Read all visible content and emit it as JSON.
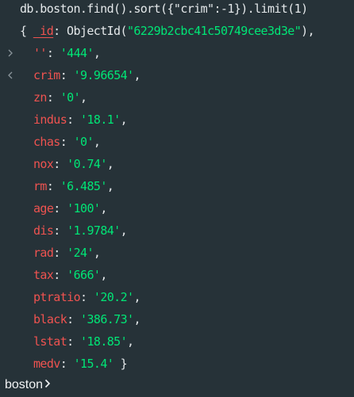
{
  "command": "db.boston.find().sort({\"crim\":-1}).limit(1)",
  "result": {
    "open_brace": "{",
    "id_key": "_id",
    "id_func": "ObjectId(",
    "id_value": "\"6229b2cbc41c50749cee3d3e\"",
    "id_close": "),",
    "fields": [
      {
        "key": "''",
        "value": "'444'"
      },
      {
        "key": "crim",
        "value": "'9.96654'"
      },
      {
        "key": "zn",
        "value": "'0'"
      },
      {
        "key": "indus",
        "value": "'18.1'"
      },
      {
        "key": "chas",
        "value": "'0'"
      },
      {
        "key": "nox",
        "value": "'0.74'"
      },
      {
        "key": "rm",
        "value": "'6.485'"
      },
      {
        "key": "age",
        "value": "'100'"
      },
      {
        "key": "dis",
        "value": "'1.9784'"
      },
      {
        "key": "rad",
        "value": "'24'"
      },
      {
        "key": "tax",
        "value": "'666'"
      },
      {
        "key": "ptratio",
        "value": "'20.2'"
      },
      {
        "key": "black",
        "value": "'386.73'"
      },
      {
        "key": "lstat",
        "value": "'18.85'"
      },
      {
        "key": "medv",
        "value": "'15.4'"
      }
    ],
    "close_brace": "}"
  },
  "prompt": {
    "db_name": "boston"
  },
  "icons": {
    "input": "chevron-right-icon",
    "output": "chevron-left-icon",
    "prompt": "chevron-right-icon"
  },
  "colors": {
    "background": "#263238",
    "key": "#ef5350",
    "string": "#00e676",
    "text": "#e4e8ea"
  }
}
